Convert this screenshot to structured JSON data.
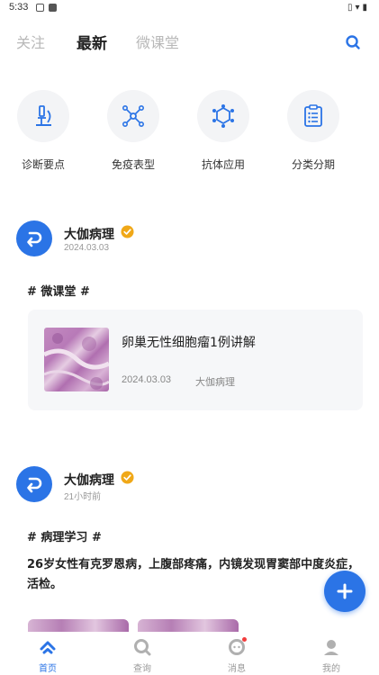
{
  "status_bar": {
    "time": "5:33",
    "icons": [
      "sim-icon",
      "notification-icon",
      "vibrate-icon",
      "wifi-icon",
      "battery-icon"
    ]
  },
  "top_nav": {
    "tabs": [
      {
        "label": "关注",
        "active": false
      },
      {
        "label": "最新",
        "active": true
      },
      {
        "label": "微课堂",
        "active": false
      }
    ],
    "search_icon": "search-icon"
  },
  "categories": [
    {
      "label": "诊断要点",
      "icon": "microscope-icon"
    },
    {
      "label": "免疫表型",
      "icon": "molecule-icon"
    },
    {
      "label": "抗体应用",
      "icon": "antibody-icon"
    },
    {
      "label": "分类分期",
      "icon": "clipboard-icon"
    }
  ],
  "posts": [
    {
      "author": "大伽病理",
      "time": "2024.03.03",
      "topic": "# 微课堂 #",
      "card": {
        "title": "卵巢无性细胞瘤1例讲解",
        "date": "2024.03.03",
        "author": "大伽病理"
      }
    },
    {
      "author": "大伽病理",
      "time": "21小时前",
      "topic": "# 病理学习 #",
      "text": "26岁女性有克罗恩病，上腹部疼痛，内镜发现胃窦部中度炎症，活检。"
    }
  ],
  "fab": {
    "icon": "plus-icon"
  },
  "bottom_tabs": [
    {
      "label": "首页",
      "icon": "home-icon",
      "active": true
    },
    {
      "label": "查询",
      "icon": "search-icon",
      "active": false
    },
    {
      "label": "消息",
      "icon": "message-icon",
      "active": false,
      "badge": true
    },
    {
      "label": "我的",
      "icon": "profile-icon",
      "active": false
    }
  ],
  "colors": {
    "accent": "#2b74e6",
    "verified": "#f0a818",
    "badge": "#f23c3c"
  }
}
